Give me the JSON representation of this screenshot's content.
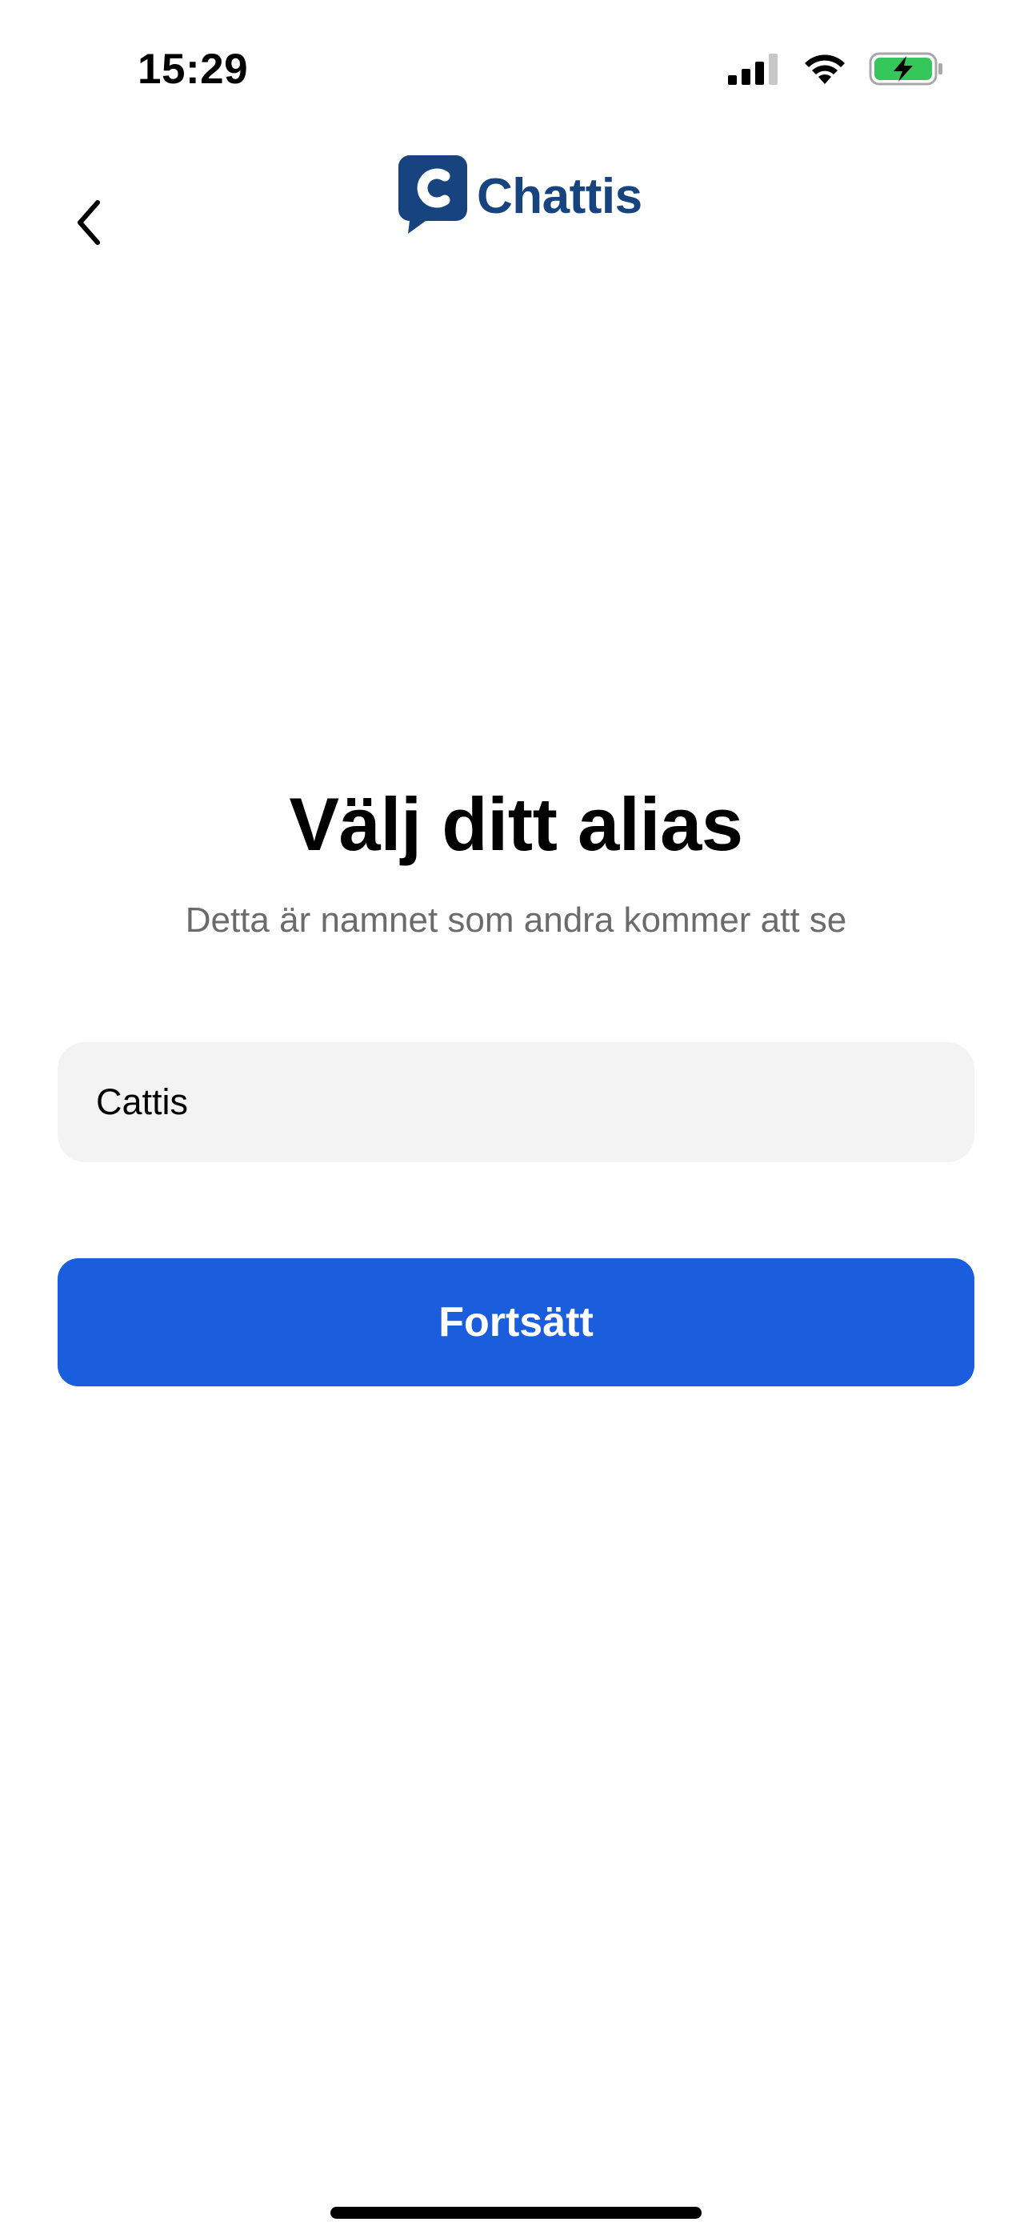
{
  "status_bar": {
    "time": "15:29",
    "icons": [
      "cellular-signal-icon",
      "wifi-icon",
      "battery-charging-icon"
    ]
  },
  "nav": {
    "back_icon": "chevron-left-icon",
    "logo_text": "Chattis",
    "logo_icon": "chat-bubble-c-icon"
  },
  "main": {
    "title": "Välj ditt alias",
    "subtitle": "Detta är namnet som andra kommer att se",
    "alias_value": "Cattis",
    "continue_label": "Fortsätt"
  },
  "colors": {
    "brand_dark_blue": "#17447f",
    "primary_button": "#1a5ddd",
    "input_background": "#f3f3f3",
    "subtitle_text": "#6b6b6b",
    "battery_green": "#35c759"
  }
}
